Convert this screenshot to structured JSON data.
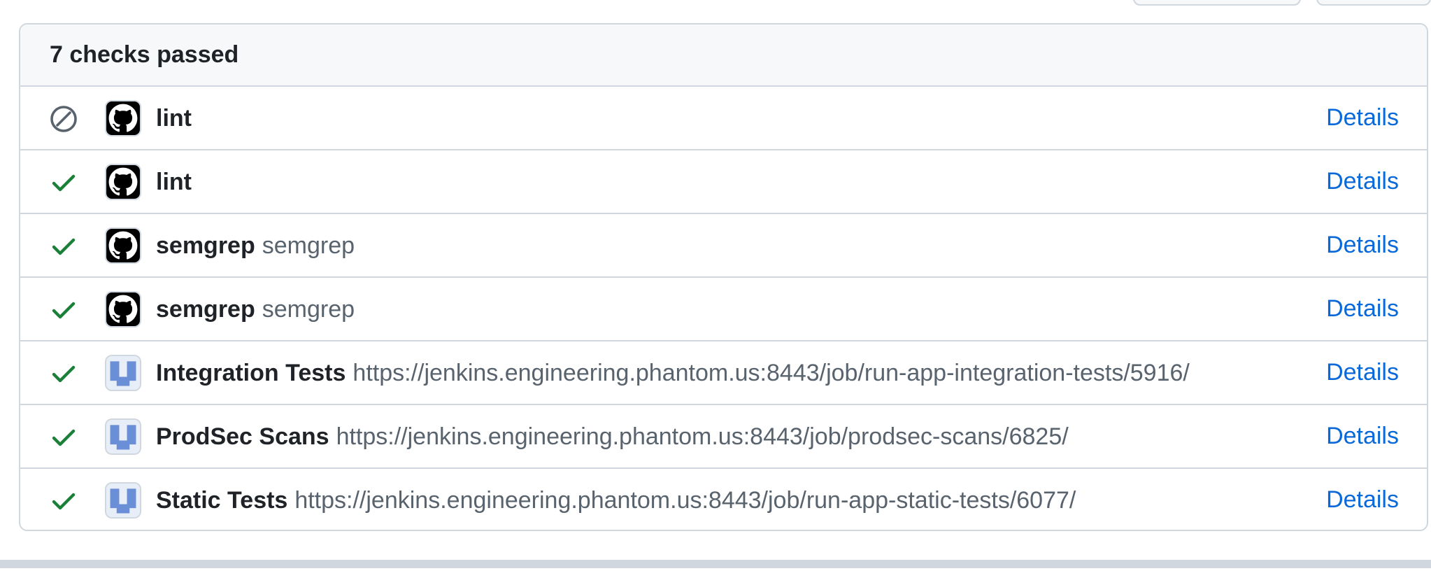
{
  "panel": {
    "title": "7 checks passed"
  },
  "checks": [
    {
      "status": "skipped",
      "status_icon": "skip-icon",
      "app_icon": "github-icon",
      "name": "lint",
      "description": "",
      "link_label": "Details"
    },
    {
      "status": "success",
      "status_icon": "check-icon",
      "app_icon": "github-icon",
      "name": "lint",
      "description": "",
      "link_label": "Details"
    },
    {
      "status": "success",
      "status_icon": "check-icon",
      "app_icon": "github-icon",
      "name": "semgrep",
      "description": "semgrep",
      "link_label": "Details"
    },
    {
      "status": "success",
      "status_icon": "check-icon",
      "app_icon": "github-icon",
      "name": "semgrep",
      "description": "semgrep",
      "link_label": "Details"
    },
    {
      "status": "success",
      "status_icon": "check-icon",
      "app_icon": "jenkins-icon",
      "name": "Integration Tests",
      "description": "https://jenkins.engineering.phantom.us:8443/job/run-app-integration-tests/5916/",
      "link_label": "Details"
    },
    {
      "status": "success",
      "status_icon": "check-icon",
      "app_icon": "jenkins-icon",
      "name": "ProdSec Scans",
      "description": "https://jenkins.engineering.phantom.us:8443/job/prodsec-scans/6825/",
      "link_label": "Details"
    },
    {
      "status": "success",
      "status_icon": "check-icon",
      "app_icon": "jenkins-icon",
      "name": "Static Tests",
      "description": "https://jenkins.engineering.phantom.us:8443/job/run-app-static-tests/6077/",
      "link_label": "Details"
    }
  ],
  "colors": {
    "success": "#1a7f37",
    "skipped": "#59636e",
    "link": "#0969da",
    "border": "#d0d7de",
    "header_bg": "#f6f8fa"
  }
}
